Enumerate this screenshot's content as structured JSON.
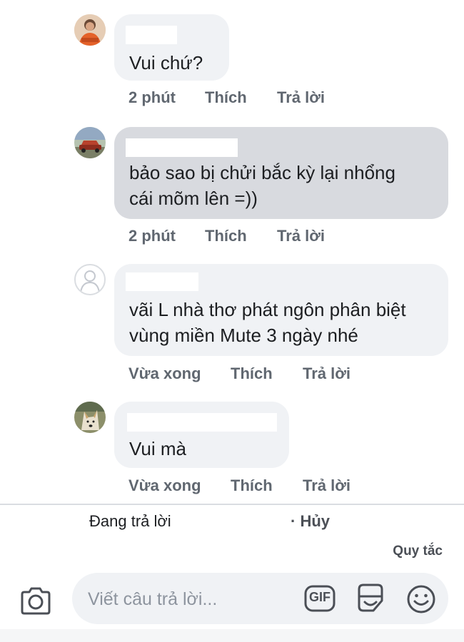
{
  "comments": [
    {
      "text_lines": [
        "Vui chứ?"
      ],
      "time": "2 phút",
      "like_label": "Thích",
      "reply_label": "Trả lời",
      "avatar": "avatar-person-orange"
    },
    {
      "text_lines": [
        "bảo sao bị chửi bắc kỳ lại nhổng",
        "cái mõm lên =))"
      ],
      "time": "2 phút",
      "like_label": "Thích",
      "reply_label": "Trả lời",
      "avatar": "avatar-car"
    },
    {
      "text_lines": [
        "vãi L nhà thơ phát ngôn phân biệt",
        "vùng miền Mute 3 ngày nhé"
      ],
      "time": "Vừa xong",
      "like_label": "Thích",
      "reply_label": "Trả lời",
      "avatar": "avatar-default-silhouette"
    },
    {
      "text_lines": [
        "Vui mà"
      ],
      "time": "Vừa xong",
      "like_label": "Thích",
      "reply_label": "Trả lời",
      "avatar": "avatar-dog"
    }
  ],
  "reply_bar": {
    "replying_label": "Đang trả lời",
    "cancel_label": "· Hủy",
    "rules_label": "Quy tắc"
  },
  "composer": {
    "placeholder": "Viết câu trả lời...",
    "gif_label": "GIF",
    "icons": [
      "camera-icon",
      "gif-icon",
      "sticker-icon",
      "emoji-icon"
    ]
  },
  "colors": {
    "bubble_light": "#f0f2f5",
    "bubble_highlight": "#d8dadf",
    "meta_text": "#606770"
  }
}
